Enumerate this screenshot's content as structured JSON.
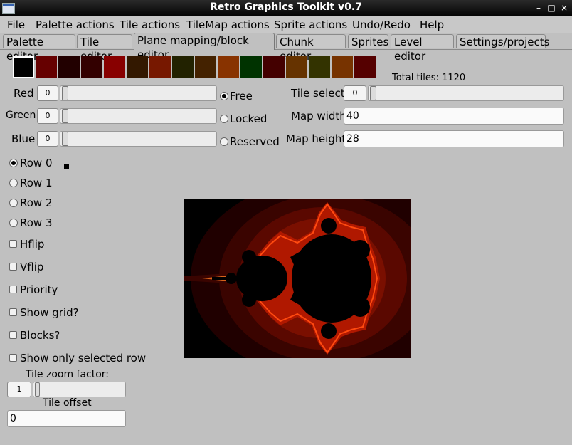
{
  "window": {
    "title": "Retro Graphics Toolkit v0.7",
    "btn_min": "–",
    "btn_max": "□",
    "btn_close": "×"
  },
  "menu": [
    "File",
    "Palette actions",
    "Tile actions",
    "TileMap actions",
    "Sprite actions",
    "Undo/Redo",
    "Help"
  ],
  "tabs": [
    "Palette editor",
    "Tile editor",
    "Plane mapping/block editor",
    "Chunk editor",
    "Sprites",
    "Level editor",
    "Settings/projects"
  ],
  "active_tab": "Plane mapping/block editor",
  "palette": {
    "colors": [
      "#000000",
      "#660000",
      "#220000",
      "#330000",
      "#880000",
      "#331800",
      "#771800",
      "#222200",
      "#442200",
      "#883300",
      "#003300",
      "#440000",
      "#663300",
      "#333300",
      "#773300",
      "#550000"
    ],
    "selected_index": 0,
    "total_tiles_label": "Total tiles: 1120"
  },
  "rgb": {
    "red_label": "Red",
    "red_value": "0",
    "green_label": "Green",
    "green_value": "0",
    "blue_label": "Blue",
    "blue_value": "0"
  },
  "mode": {
    "free": "Free",
    "locked": "Locked",
    "reserved": "Reserved",
    "selected": "Free"
  },
  "tile": {
    "select_label": "Tile select",
    "select_value": "0",
    "map_width_label": "Map width",
    "map_width": "40",
    "map_height_label": "Map height",
    "map_height": "28"
  },
  "rows": [
    "Row 0",
    "Row 1",
    "Row 2",
    "Row 3"
  ],
  "selected_row": "Row 0",
  "options": {
    "hflip": "Hflip",
    "vflip": "Vflip",
    "priority": "Priority",
    "show_grid": "Show grid?",
    "blocks": "Blocks?",
    "show_only_row": "Show only selected row"
  },
  "zoom": {
    "label": "Tile zoom factor:",
    "value": "1"
  },
  "offset": {
    "label": "Tile offset",
    "value": "0"
  },
  "colors": {
    "canvas_bg": "#000000",
    "fractal_ring": "#7a0f00",
    "fractal_edge": "#ff4a10"
  }
}
